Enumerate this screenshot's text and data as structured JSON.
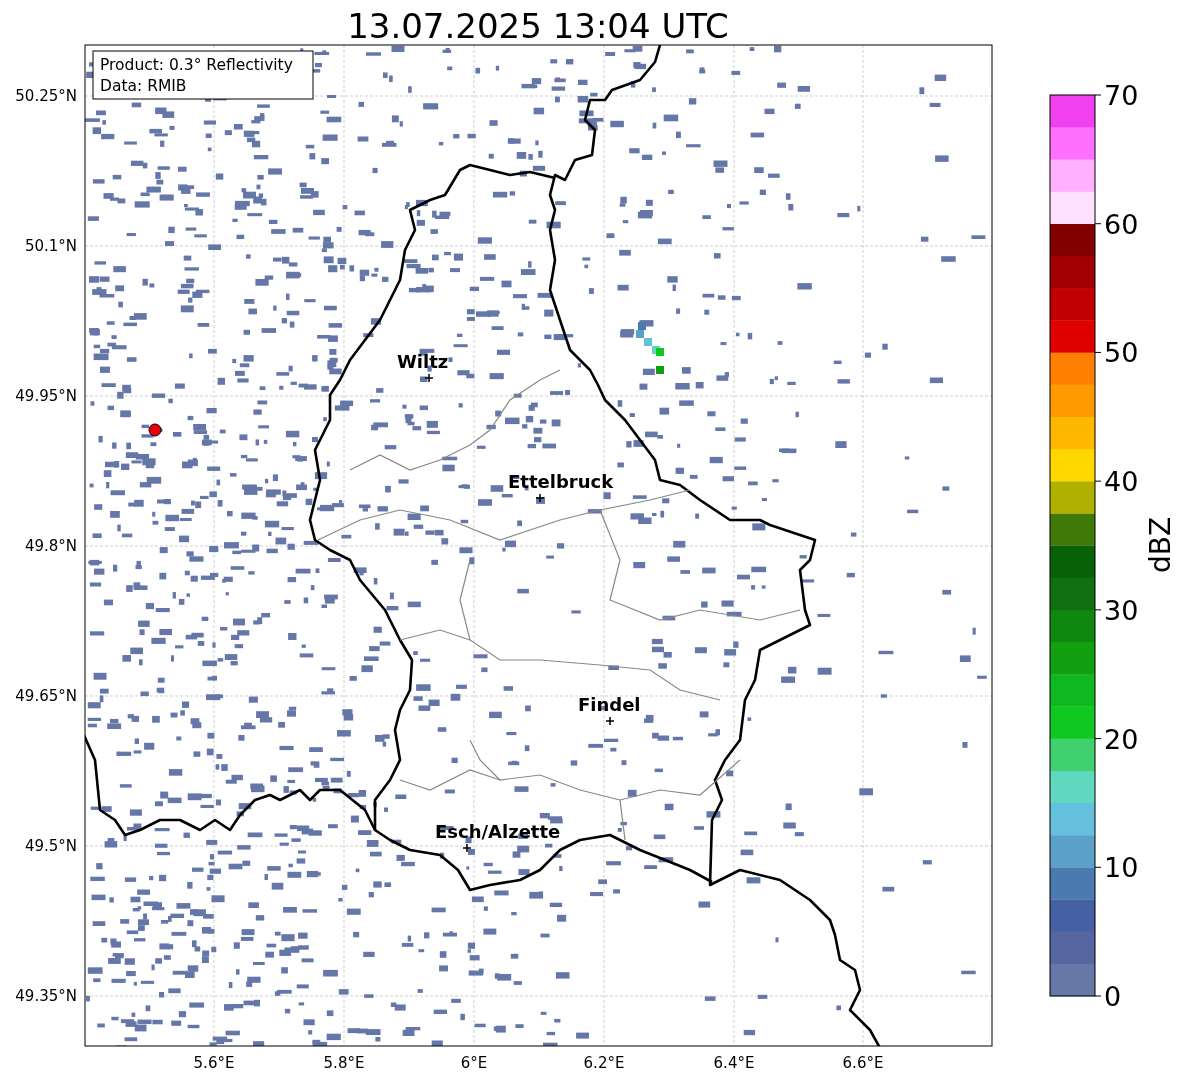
{
  "title": "13.07.2025 13:04 UTC",
  "legend": [
    "Product: 0.3° Reflectivity",
    "Data: RMIB"
  ],
  "lat_ticks": [
    "50.25°N",
    "50.1°N",
    "49.95°N",
    "49.8°N",
    "49.65°N",
    "49.5°N",
    "49.35°N"
  ],
  "lon_ticks": [
    "5.6°E",
    "5.8°E",
    "6°E",
    "6.2°E",
    "6.4°E",
    "6.6°E"
  ],
  "cities": [
    {
      "name": "Wiltz"
    },
    {
      "name": "Ettelbruck"
    },
    {
      "name": "Findel"
    },
    {
      "name": "Esch/Alzette"
    }
  ],
  "colorbar": {
    "label": "dBZ",
    "ticks": [
      "70",
      "60",
      "50",
      "40",
      "30",
      "20",
      "10",
      "0"
    ],
    "segments": [
      {
        "color": "#6677a8"
      },
      {
        "color": "#5566a0"
      },
      {
        "color": "#4660a4"
      },
      {
        "color": "#4a7ab0"
      },
      {
        "color": "#5aa0c8"
      },
      {
        "color": "#64c0dc"
      },
      {
        "color": "#60d8c0"
      },
      {
        "color": "#40d070"
      },
      {
        "color": "#10c820"
      },
      {
        "color": "#10b820"
      },
      {
        "color": "#10a010"
      },
      {
        "color": "#108810"
      },
      {
        "color": "#107010"
      },
      {
        "color": "#086008"
      },
      {
        "color": "#3f7a08"
      },
      {
        "color": "#b0b000"
      },
      {
        "color": "#ffd800"
      },
      {
        "color": "#ffb800"
      },
      {
        "color": "#ff9a00"
      },
      {
        "color": "#ff8000"
      },
      {
        "color": "#e00000"
      },
      {
        "color": "#c00000"
      },
      {
        "color": "#a00000"
      },
      {
        "color": "#800000"
      },
      {
        "color": "#ffe0ff"
      },
      {
        "color": "#ffb0ff"
      },
      {
        "color": "#ff70ff"
      },
      {
        "color": "#f040f0"
      }
    ]
  }
}
